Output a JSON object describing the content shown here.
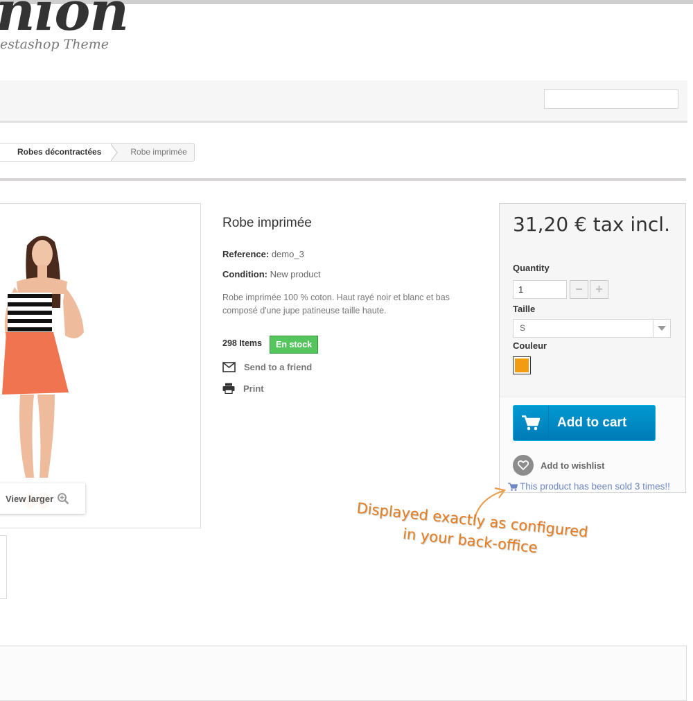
{
  "header": {
    "logo_text": "nion",
    "logo_subtitle": "estashop Theme"
  },
  "search": {
    "value": "",
    "placeholder": ""
  },
  "breadcrumb": {
    "items": [
      "Robes décontractées",
      "Robe imprimée"
    ]
  },
  "image": {
    "view_larger_label": "View larger"
  },
  "product": {
    "title": "Robe imprimée",
    "reference_label": "Reference:",
    "reference_value": "demo_3",
    "condition_label": "Condition:",
    "condition_value": "New product",
    "description": "Robe imprimée 100 % coton. Haut rayé noir et blanc et bas composé d'une jupe patineuse taille haute.",
    "items_count": "298 Items",
    "stock_badge": "En stock",
    "send_to_friend": "Send to a friend",
    "print": "Print"
  },
  "buy_box": {
    "price": "31,20 € tax incl.",
    "quantity_label": "Quantity",
    "quantity_value": "1",
    "minus_symbol": "−",
    "plus_symbol": "+",
    "size_label": "Taille",
    "size_value": "S",
    "color_label": "Couleur",
    "color_swatch": "#f39c11",
    "add_to_cart": "Add to cart",
    "wishlist": "Add to wishlist",
    "sold_text": "This product has been sold 3 times!!"
  },
  "annotation": {
    "line1": "Displayed exactly as configured",
    "line2": "in your back-office"
  },
  "colors": {
    "accent_blue": "#009ad0",
    "stock_green": "#55c65e",
    "annotation_orange": "#e87e1e",
    "sold_link": "#6e86c1"
  }
}
